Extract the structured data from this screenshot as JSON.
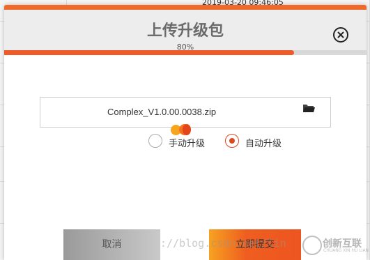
{
  "background": {
    "peek_text": "2019-03-20 09:46:05"
  },
  "dialog": {
    "title": "上传升级包",
    "progress_text": "80%",
    "progress_value": 0.8,
    "file_name": "Complex_V1.0.00.0038.zip",
    "radio_options": [
      {
        "label": "手动升级",
        "checked": false
      },
      {
        "label": "自动升级",
        "checked": true
      }
    ],
    "cancel_label": "取消",
    "submit_label": "立即提交",
    "colors": {
      "accent": "#ef6a2a",
      "radio_checked": "#d84a1f"
    },
    "icons": {
      "close": "close-circle-icon",
      "folder": "folder-open-icon"
    }
  },
  "watermark": {
    "url_text": "://blog.csdn.net/lin",
    "brand": "创新互联",
    "brand_sub": "CHUANG XIN HU LIAN"
  }
}
